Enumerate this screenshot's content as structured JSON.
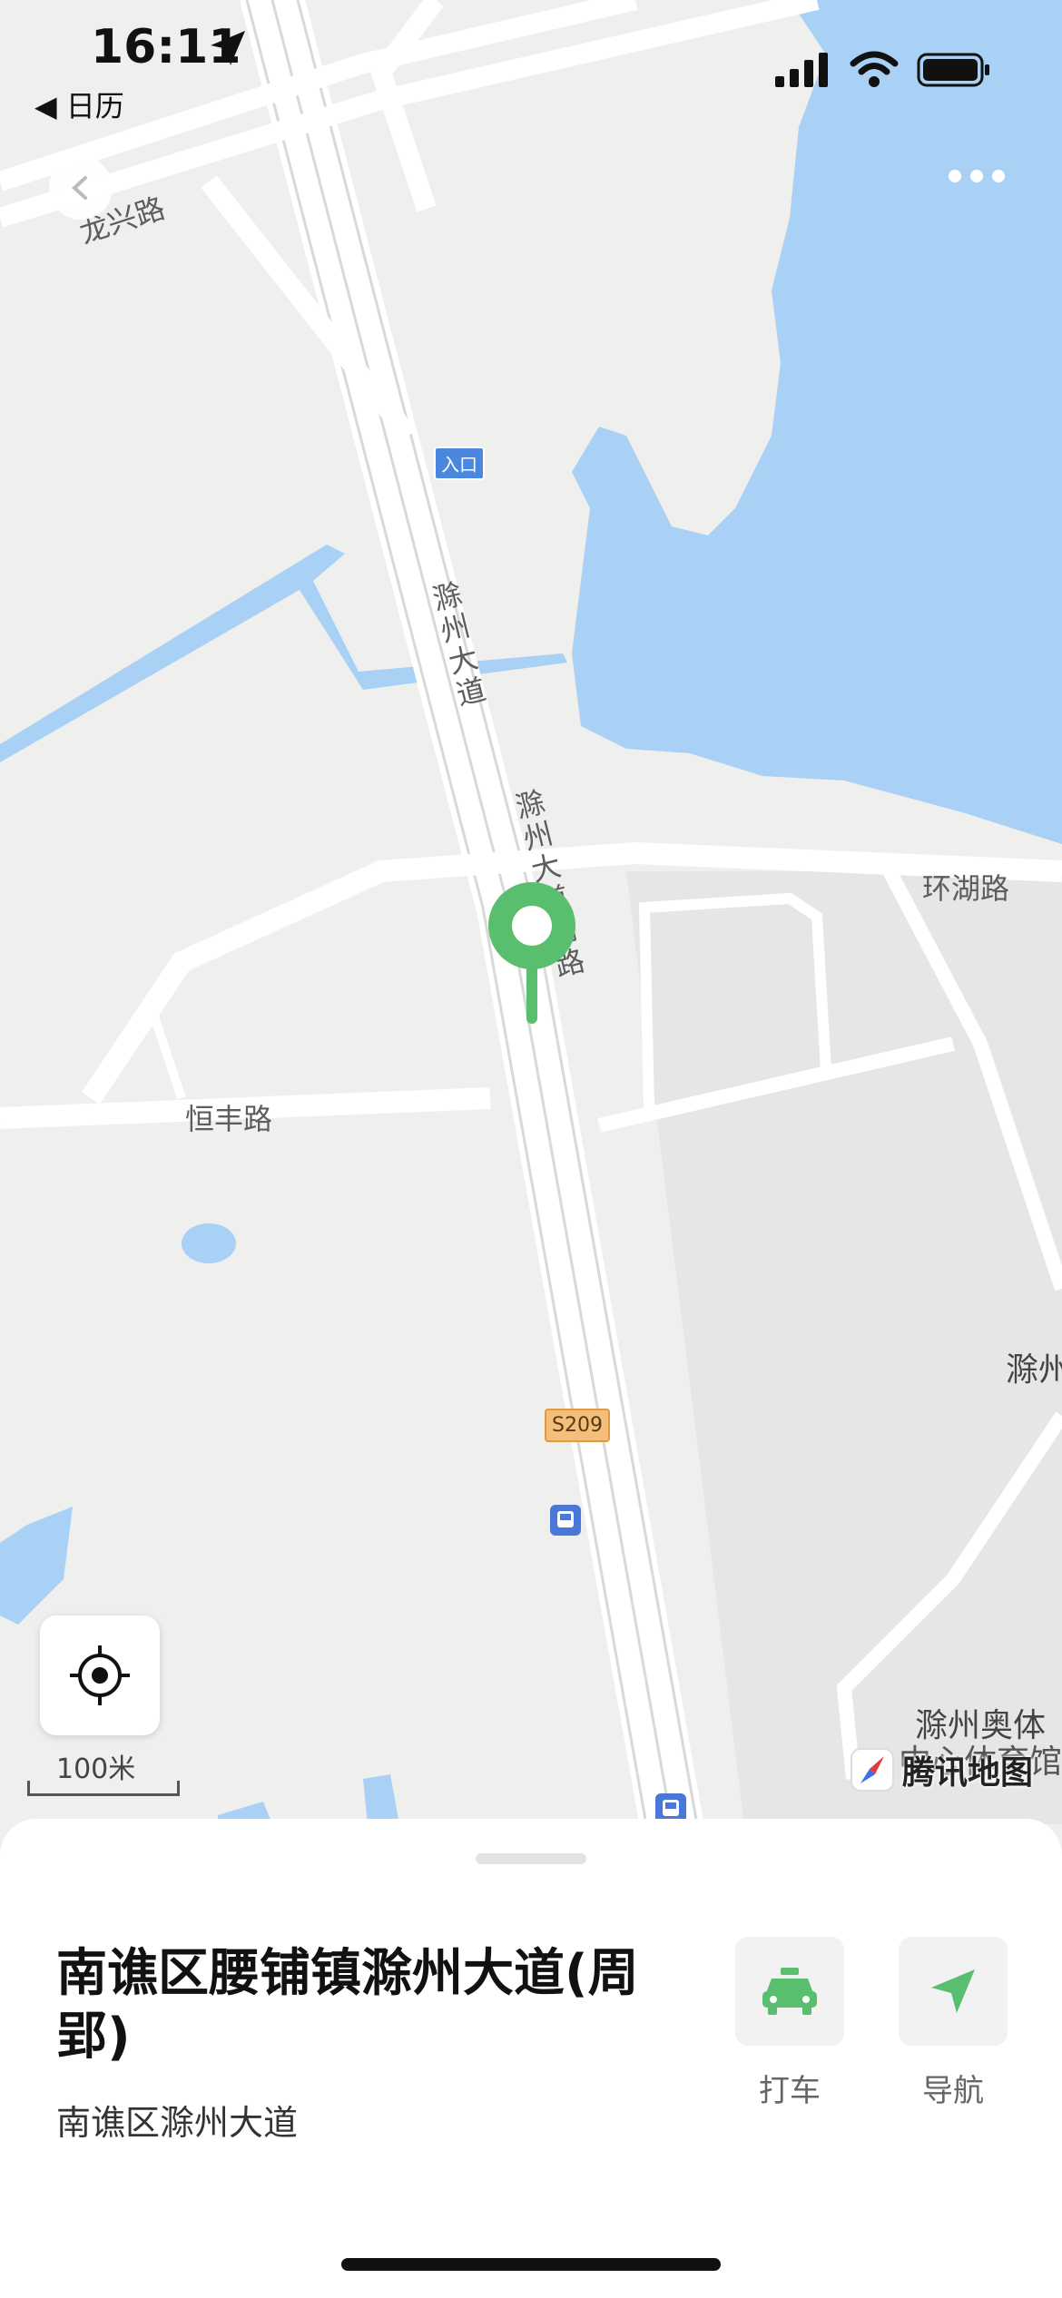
{
  "status_bar": {
    "time": "16:11",
    "back_app": "◀ 日历",
    "icons": [
      "location-arrow-icon",
      "signal-icon",
      "wifi-icon",
      "battery-icon"
    ]
  },
  "map": {
    "road_labels": {
      "longxing": "龙兴路",
      "chuzhou_avenue": "滁州大道",
      "chuzhou_avenue_aux": "滁州大道辅路",
      "huanhu": "环湖路",
      "hengfeng": "恒丰路",
      "chuzhou_right": "滁州",
      "olympic": "滁州奥体",
      "olympic_2": "中心体育馆"
    },
    "badges": {
      "entrance": "入口",
      "highway": "S209"
    },
    "scale_label": "100米",
    "provider": "腾讯地图",
    "colors": {
      "water": "#a9d0f5",
      "land": "#efefed",
      "road": "#ffffff",
      "pin": "#59be6e"
    }
  },
  "place": {
    "title": "南谯区腰铺镇滁州大道(周郢)",
    "subtitle": "南谯区滁州大道"
  },
  "actions": {
    "taxi_label": "打车",
    "navigate_label": "导航",
    "accent": "#59be6e"
  }
}
